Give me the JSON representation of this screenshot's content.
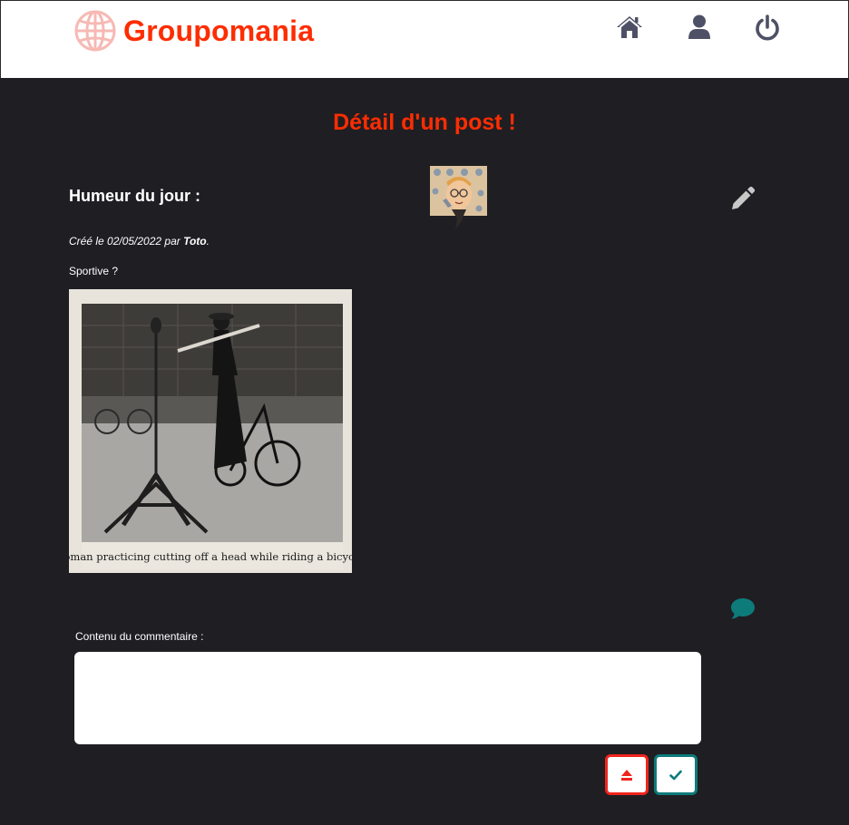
{
  "header": {
    "brand": "Groupomania",
    "nav": [
      {
        "name": "home",
        "icon": "home-icon"
      },
      {
        "name": "profile",
        "icon": "user-icon"
      },
      {
        "name": "logout",
        "icon": "power-icon"
      }
    ]
  },
  "page": {
    "title": "Détail d'un post !"
  },
  "post": {
    "title": "Humeur du jour :",
    "created_prefix": "Créé le 02/05/2022 par ",
    "author": "Toto",
    "created_suffix": ".",
    "body": "Sportive ?",
    "image_caption": "Woman practicing cutting off a head while riding a bicycle."
  },
  "comment_form": {
    "label": "Contenu du commentaire :",
    "placeholder": "",
    "value": ""
  },
  "colors": {
    "brand": "#fd2d01",
    "background": "#1f1e23",
    "icon": "#4e5166",
    "accent": "#0d7b7a"
  }
}
